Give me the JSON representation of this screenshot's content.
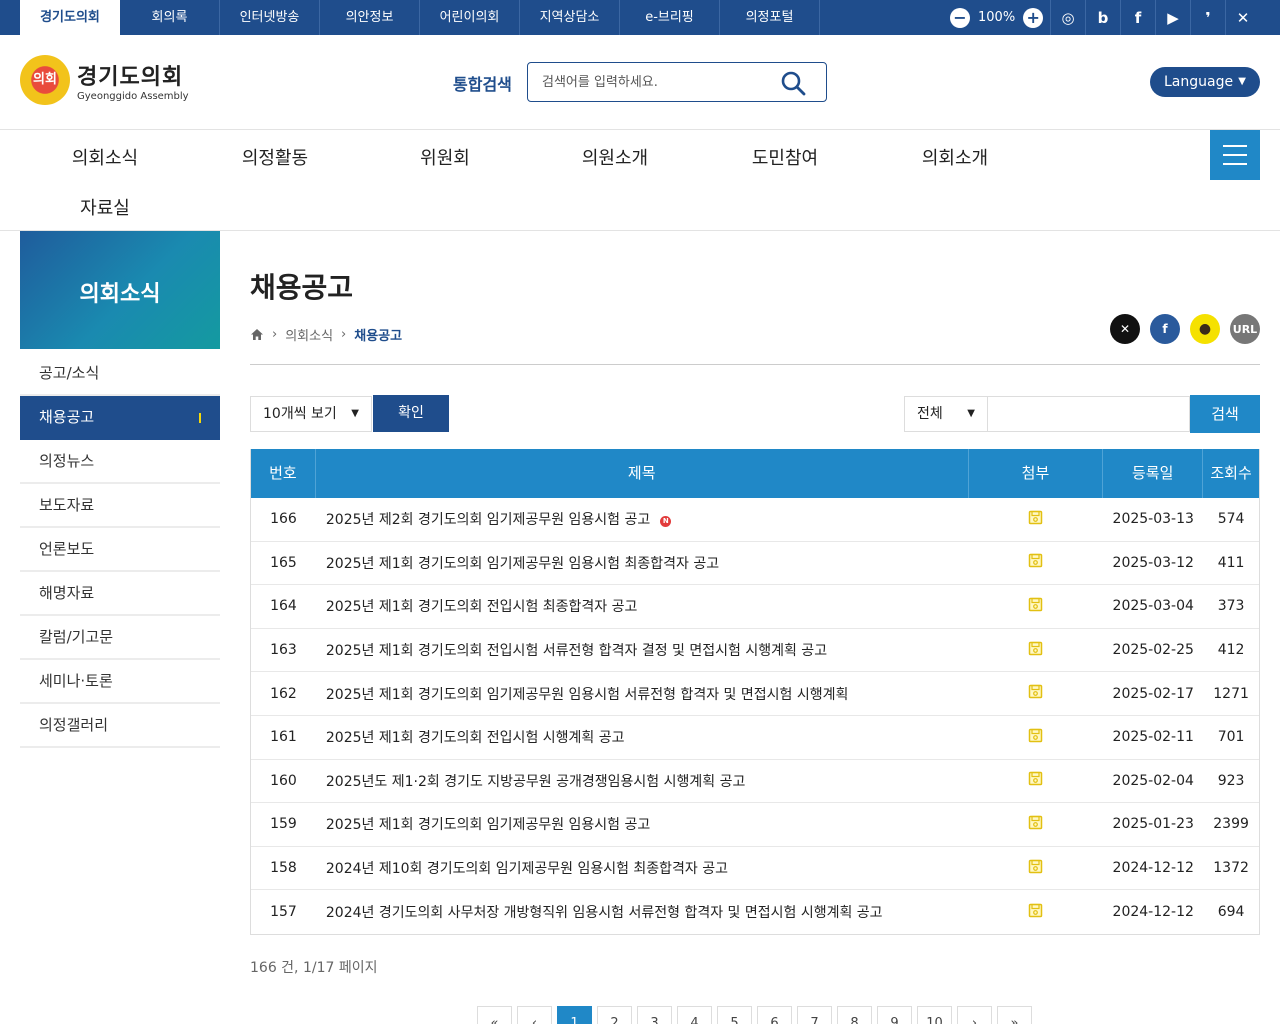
{
  "topnav": [
    "경기도의회",
    "회의록",
    "인터넷방송",
    "의안정보",
    "어린이의회",
    "지역상담소",
    "e-브리핑",
    "의정포털"
  ],
  "zoom": {
    "minus": "−",
    "level": "100%",
    "plus": "+"
  },
  "sns_top": [
    {
      "icon": "instagram-icon",
      "glyph": "◎"
    },
    {
      "icon": "blog-icon",
      "glyph": "b"
    },
    {
      "icon": "facebook-icon",
      "glyph": "f"
    },
    {
      "icon": "youtube-icon",
      "glyph": "▶"
    },
    {
      "icon": "story-icon",
      "glyph": "❜"
    },
    {
      "icon": "x-icon",
      "glyph": "✕"
    }
  ],
  "logo": {
    "mark": "의회",
    "name": "경기도의회",
    "sub": "Gyeonggido Assembly"
  },
  "search": {
    "label": "통합검색",
    "placeholder": "검색어를 입력하세요."
  },
  "language": {
    "label": "Language",
    "caret": "▼"
  },
  "gnb": [
    "의회소식",
    "의정활동",
    "위원회",
    "의원소개",
    "도민참여",
    "의회소개",
    "자료실"
  ],
  "sidebar": {
    "title": "의회소식",
    "items": [
      "공고/소식",
      "채용공고",
      "의정뉴스",
      "보도자료",
      "언론보도",
      "해명자료",
      "칼럼/기고문",
      "세미나·토론",
      "의정갤러리"
    ],
    "active": "채용공고"
  },
  "page": {
    "title": "채용공고",
    "breadcrumb": [
      "의회소식",
      "채용공고"
    ]
  },
  "share": [
    {
      "icon": "x-icon",
      "glyph": "✕",
      "color": "#111111"
    },
    {
      "icon": "facebook-icon",
      "glyph": "f",
      "color": "#2a5a9c"
    },
    {
      "icon": "kakaotalk-icon",
      "glyph": "●",
      "color": "#f5e100"
    },
    {
      "icon": "url-icon",
      "glyph": "URL",
      "color": "#777777"
    }
  ],
  "controls": {
    "perpage": "10개씩 보기",
    "confirm": "확인",
    "filter": "전체",
    "keyword_value": "",
    "search": "검색"
  },
  "table": {
    "headers": [
      "번호",
      "제목",
      "첨부",
      "등록일",
      "조회수"
    ],
    "rows": [
      {
        "num": "166",
        "title": "2025년 제2회 경기도의회 임기제공무원 임용시험 공고",
        "new": true,
        "date": "2025-03-13",
        "views": "574"
      },
      {
        "num": "165",
        "title": "2025년 제1회 경기도의회 임기제공무원 임용시험 최종합격자 공고",
        "new": false,
        "date": "2025-03-12",
        "views": "411"
      },
      {
        "num": "164",
        "title": "2025년 제1회 경기도의회 전입시험 최종합격자 공고",
        "new": false,
        "date": "2025-03-04",
        "views": "373"
      },
      {
        "num": "163",
        "title": "2025년 제1회 경기도의회 전입시험 서류전형 합격자 결정 및 면접시험 시행계획 공고",
        "new": false,
        "date": "2025-02-25",
        "views": "412"
      },
      {
        "num": "162",
        "title": "2025년 제1회 경기도의회 임기제공무원 임용시험 서류전형 합격자 및 면접시험 시행계획",
        "new": false,
        "date": "2025-02-17",
        "views": "1271"
      },
      {
        "num": "161",
        "title": "2025년 제1회 경기도의회 전입시험 시행계획 공고",
        "new": false,
        "date": "2025-02-11",
        "views": "701"
      },
      {
        "num": "160",
        "title": "2025년도 제1·2회 경기도 지방공무원 공개경쟁임용시험 시행계획 공고",
        "new": false,
        "date": "2025-02-04",
        "views": "923"
      },
      {
        "num": "159",
        "title": "2025년 제1회 경기도의회 임기제공무원 임용시험 공고",
        "new": false,
        "date": "2025-01-23",
        "views": "2399"
      },
      {
        "num": "158",
        "title": "2024년 제10회 경기도의회 임기제공무원 임용시험 최종합격자 공고",
        "new": false,
        "date": "2024-12-12",
        "views": "1372"
      },
      {
        "num": "157",
        "title": "2024년 경기도의회 사무처장 개방형직위 임용시험 서류전형 합격자 및 면접시험 시행계획 공고",
        "new": false,
        "date": "2024-12-12",
        "views": "694"
      }
    ],
    "new_badge": "N"
  },
  "summary": "166 건, 1/17 페이지",
  "pager": {
    "first": "«",
    "prev": "‹",
    "pages": [
      "1",
      "2",
      "3",
      "4",
      "5",
      "6",
      "7",
      "8",
      "9",
      "10"
    ],
    "current": "1",
    "next": "›",
    "last": "»"
  },
  "colors": {
    "primary": "#1f4d8c",
    "accent": "#2088c7",
    "attach": "#e2c012"
  }
}
